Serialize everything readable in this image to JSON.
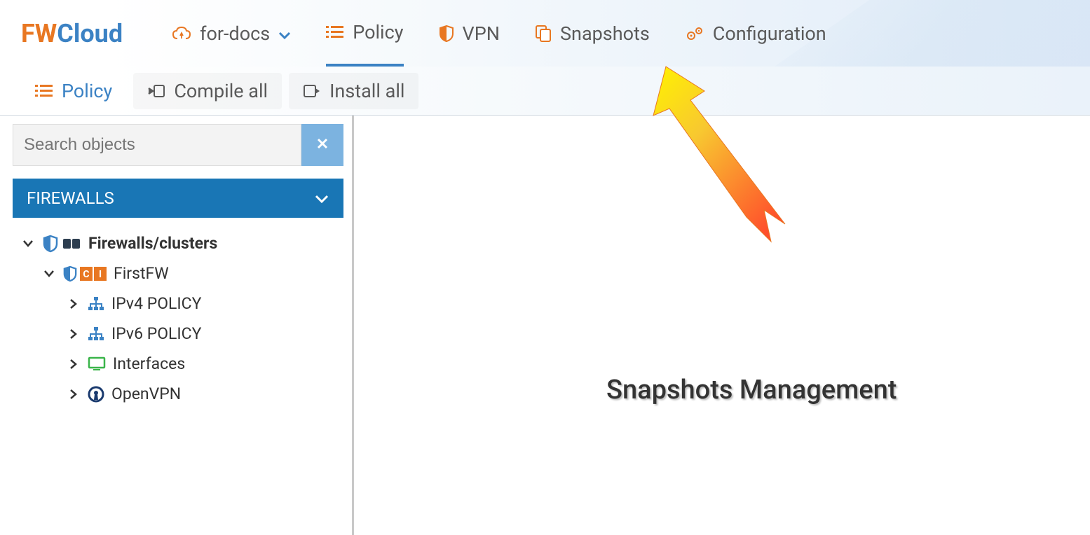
{
  "logo": {
    "part1": "FW",
    "part2": "Cloud"
  },
  "topnav": {
    "project_selector": "for-docs",
    "items": [
      {
        "label": "Policy",
        "icon": "list"
      },
      {
        "label": "VPN",
        "icon": "shield"
      },
      {
        "label": "Snapshots",
        "icon": "copy"
      },
      {
        "label": "Configuration",
        "icon": "gears"
      }
    ]
  },
  "subnav": {
    "policy": "Policy",
    "compile_all": "Compile all",
    "install_all": "Install all"
  },
  "sidebar": {
    "search_placeholder": "Search objects",
    "section_header": "FIREWALLS",
    "tree": {
      "root_label": "Firewalls/clusters",
      "firewall": {
        "label": "FirstFW",
        "children": [
          {
            "label": "IPv4 POLICY",
            "icon": "sitemap"
          },
          {
            "label": "IPv6 POLICY",
            "icon": "sitemap"
          },
          {
            "label": "Interfaces",
            "icon": "monitor"
          },
          {
            "label": "OpenVPN",
            "icon": "openvpn"
          }
        ]
      }
    }
  },
  "annotation": {
    "label": "Snapshots Management"
  },
  "colors": {
    "orange": "#e87722",
    "blue": "#3b82c4",
    "dark_blue": "#1976b5",
    "green": "#3ab54a"
  }
}
